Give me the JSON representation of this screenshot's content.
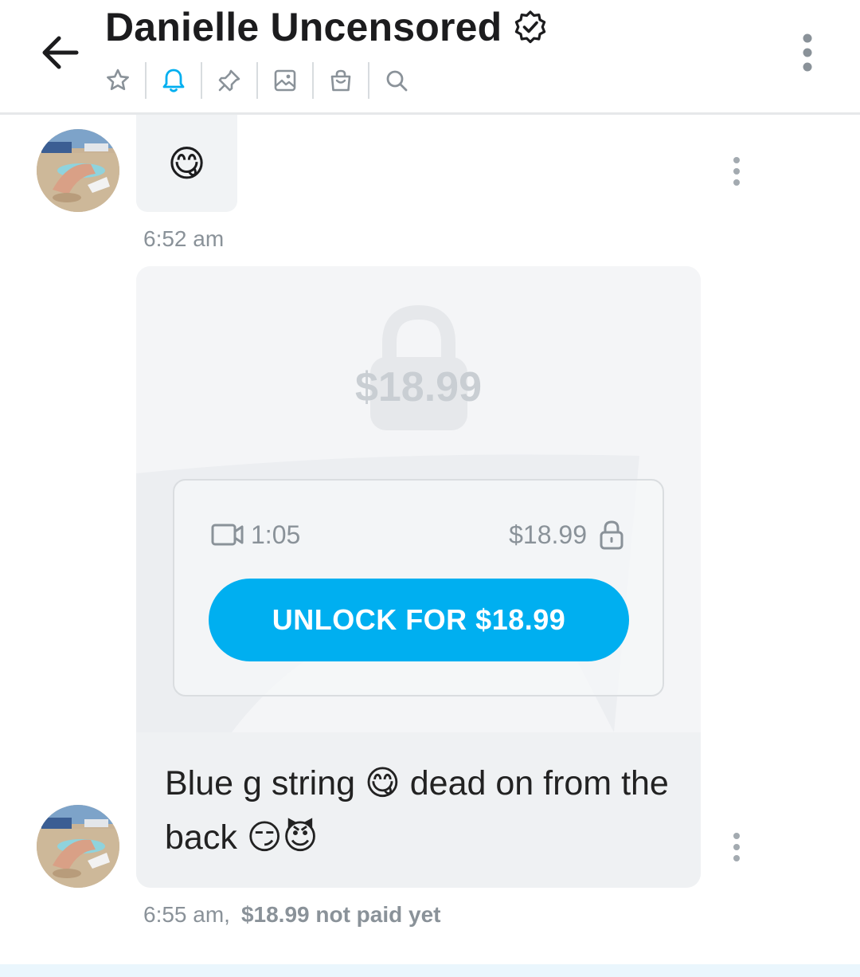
{
  "header": {
    "title": "Danielle Uncensored",
    "toolbar_icons": [
      "star-icon",
      "bell-icon",
      "pin-icon",
      "image-icon",
      "shopping-bag-icon",
      "search-icon"
    ]
  },
  "colors": {
    "accent": "#00aff0",
    "bubble": "#f1f3f5",
    "muted_text": "#8a9299"
  },
  "messages": [
    {
      "text": "😋",
      "time": "6:52 am"
    },
    {
      "media": {
        "locked_price": "$18.99",
        "duration": "1:05",
        "price": "$18.99",
        "unlock_label": "UNLOCK FOR $18.99"
      },
      "text": "Blue g string 😋 dead on from the back 😏😈",
      "time": "6:55 am,",
      "status": "$18.99 not paid yet"
    }
  ]
}
